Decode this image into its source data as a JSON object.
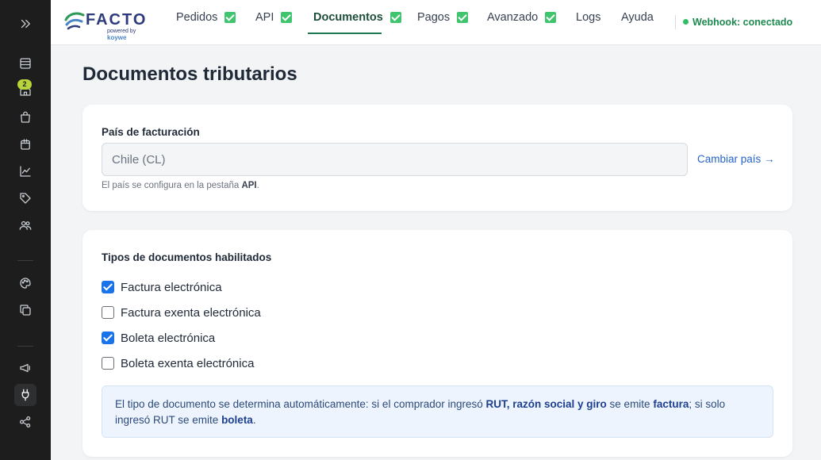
{
  "sidebar": {
    "expand_icon": "double-chevron-right-icon",
    "icons": [
      "store-icon",
      "home-icon",
      "shopping-bag-icon",
      "package-icon",
      "chart-icon",
      "tag-icon",
      "users-icon",
      "palette-icon",
      "copy-icon",
      "megaphone-icon",
      "plug-icon",
      "share-icon"
    ],
    "badge_count": "2",
    "active_icon": "plug-icon"
  },
  "header": {
    "logo": {
      "word": "FACTO",
      "sub_prefix": "powered by",
      "sub_brand": "koywe"
    },
    "nav": [
      {
        "label": "Pedidos",
        "checked": true
      },
      {
        "label": "API",
        "checked": true
      },
      {
        "label": "Documentos",
        "checked": true,
        "active": true
      },
      {
        "label": "Pagos",
        "checked": true
      },
      {
        "label": "Avanzado",
        "checked": true
      },
      {
        "label": "Logs",
        "checked": false
      },
      {
        "label": "Ayuda",
        "checked": false
      }
    ],
    "webhook_status": "Webhook: conectado"
  },
  "main": {
    "title": "Documentos tributarios",
    "country": {
      "label": "País de facturación",
      "value": "Chile (CL)",
      "change_link": "Cambiar país →",
      "hint_prefix": "El país se configura en la pestaña ",
      "hint_bold": "API",
      "hint_suffix": "."
    },
    "doc_types": {
      "label": "Tipos de documentos habilitados",
      "items": [
        {
          "label": "Factura electrónica",
          "checked": true
        },
        {
          "label": "Factura exenta electrónica",
          "checked": false
        },
        {
          "label": "Boleta electrónica",
          "checked": true
        },
        {
          "label": "Boleta exenta electrónica",
          "checked": false
        }
      ],
      "info": {
        "p1": "El tipo de documento se determina automáticamente: si el comprador ingresó ",
        "b1": "RUT, razón social y giro",
        "p2": " se emite ",
        "b2": "factura",
        "p3": "; si solo ingresó RUT se emite ",
        "b3": "boleta",
        "p4": "."
      }
    }
  },
  "colors": {
    "rail_bg": "#1d1d1d",
    "nav_check": "#40c46d",
    "active_tab": "#1e7a4e",
    "webhook": "#1e8a4f",
    "checkbox_on": "#1a73e8",
    "link": "#2563c9",
    "info_bg": "#eef4fd"
  }
}
